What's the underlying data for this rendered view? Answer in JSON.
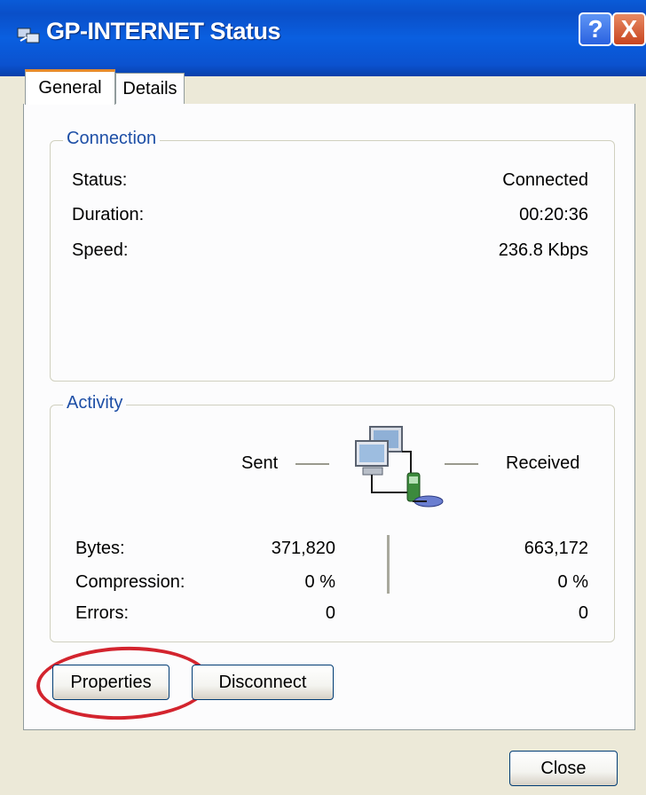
{
  "window": {
    "title": "GP-INTERNET Status",
    "help_glyph": "?",
    "close_glyph": "X"
  },
  "tabs": [
    {
      "label": "General",
      "active": true
    },
    {
      "label": "Details",
      "active": false
    }
  ],
  "connection": {
    "group_label": "Connection",
    "rows": [
      {
        "label": "Status:",
        "value": "Connected"
      },
      {
        "label": "Duration:",
        "value": "00:20:36"
      },
      {
        "label": "Speed:",
        "value": "236.8 Kbps"
      }
    ]
  },
  "activity": {
    "group_label": "Activity",
    "sent_label": "Sent",
    "received_label": "Received",
    "rows": [
      {
        "label": "Bytes:",
        "sent": "371,820",
        "received": "663,172"
      },
      {
        "label": "Compression:",
        "sent": "0 %",
        "received": "0 %"
      },
      {
        "label": "Errors:",
        "sent": "0",
        "received": "0"
      }
    ]
  },
  "buttons": {
    "properties": "Properties",
    "disconnect": "Disconnect",
    "close": "Close"
  },
  "colors": {
    "titlebar": "#0a5bd8",
    "group_label": "#1e4fa6",
    "highlight_ring": "#d3242e",
    "active_tab_accent": "#e68b2c"
  },
  "icons": {
    "title": "network-connection-icon",
    "activity": "network-computers-icon"
  }
}
